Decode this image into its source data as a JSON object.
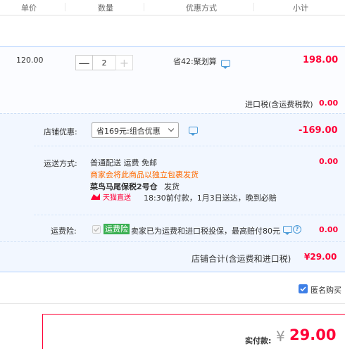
{
  "header": {
    "col_price": "单价",
    "col_qty": "数量",
    "col_discount": "优惠方式",
    "col_subtotal": "小计"
  },
  "item": {
    "unit_price": "120.00",
    "quantity": "2",
    "minus": "—",
    "plus": "+",
    "promo": "省42:聚划算",
    "subtotal": "198.00",
    "tax_label": "进口税(含运费税款)",
    "tax_value": "0.00"
  },
  "shop": {
    "discount_label": "店铺优惠:",
    "discount_select": "省169元:组合优惠",
    "discount_value": "-169.00",
    "shipping_label": "运送方式:",
    "shipping_method": "普通配送 运费 免邮",
    "shipping_note": "商家会将此商品以独立包裹发货",
    "warehouse": "菜鸟马尾保税2号仓",
    "warehouse_suffix": "发货",
    "tmall_badge": "天猫直送",
    "delivery_promise": "18:30前付款，1月3日送达，晚到必赔",
    "shipping_value": "0.00",
    "insurance_label": "运费险:",
    "insurance_badge": "运费险",
    "insurance_desc": "卖家已为运费和进口税投保，最高赔付80元",
    "insurance_value": "0.00",
    "total_label": "店铺合计(含运费和进口税)",
    "total_value": "¥29.00"
  },
  "anonymous": {
    "label": "匿名购买",
    "checked": true
  },
  "payment": {
    "label": "实付款:",
    "currency": "¥",
    "amount": "29.00"
  },
  "colors": {
    "accent_red": "#ff0036",
    "link_blue": "#4c9bd8",
    "insurance_green": "#3bb053",
    "note_orange": "#ff6a00"
  }
}
